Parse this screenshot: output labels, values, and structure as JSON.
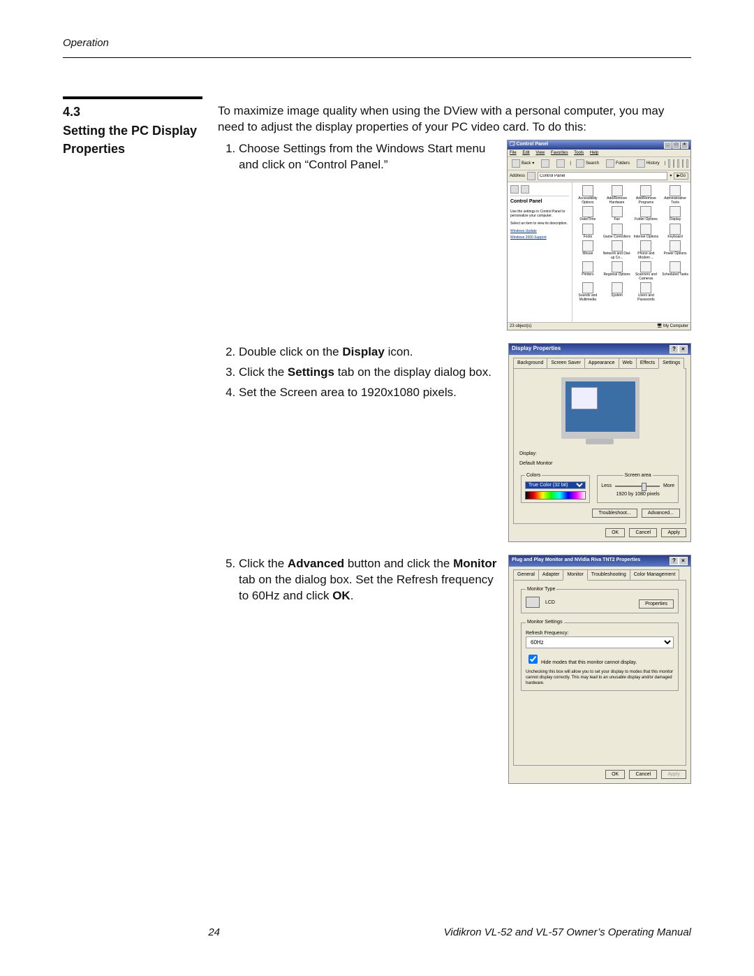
{
  "header": {
    "section_label": "Operation"
  },
  "section": {
    "number": "4.3",
    "title_line1": "Setting the PC Display",
    "title_line2": "Properties"
  },
  "intro": "To maximize image quality when using the DView with a personal computer, you may need to adjust the display properties of your PC video card. To do this:",
  "steps_a": {
    "s1": "Choose Settings from the Windows Start menu and click on “Control Panel.”"
  },
  "steps_b": {
    "s2_pre": "Double click on the ",
    "s2_bold": "Display",
    "s2_post": " icon.",
    "s3_pre": "Click the ",
    "s3_bold": "Settings",
    "s3_post": " tab on the display dialog box.",
    "s4": "Set the Screen area to 1920x1080 pixels."
  },
  "steps_c": {
    "s5_pre": "Click the ",
    "s5_b1": "Advanced",
    "s5_mid": " button and click the ",
    "s5_b2": "Monitor",
    "s5_mid2": " tab on the dialog box. Set the Refresh frequency to 60Hz and click ",
    "s5_b3": "OK",
    "s5_post": "."
  },
  "cp": {
    "title": "Control Panel",
    "menus": [
      "File",
      "Edit",
      "View",
      "Favorites",
      "Tools",
      "Help"
    ],
    "tools": {
      "back": "Back",
      "search": "Search",
      "folders": "Folders",
      "history": "History"
    },
    "address_label": "Address",
    "address_value": "Control Panel",
    "go": "Go",
    "side": {
      "head": "Control Panel",
      "desc1": "Use the settings in Control Panel to personalize your computer.",
      "desc2": "Select an item to view its description.",
      "link1": "Windows Update",
      "link2": "Windows 2000 Support"
    },
    "items": [
      "Accessibility Options",
      "Add/Remove Hardware",
      "Add/Remove Programs",
      "Administrative Tools",
      "Date/Time",
      "Fax",
      "Folder Options",
      "Display",
      "Fonts",
      "Game Controllers",
      "Internet Options",
      "Keyboard",
      "Mouse",
      "Network and Dial-up Co...",
      "Phone and Modem ...",
      "Power Options",
      "Printers",
      "Regional Options",
      "Scanners and Cameras",
      "Scheduled Tasks",
      "Sounds and Multimedia",
      "System",
      "Users and Passwords"
    ],
    "status_left": "23 object(s)",
    "status_right": "My Computer"
  },
  "dp": {
    "title": "Display Properties",
    "tabs": [
      "Background",
      "Screen Saver",
      "Appearance",
      "Web",
      "Effects",
      "Settings"
    ],
    "display_label": "Display:",
    "display_name": "Default Monitor",
    "colors_legend": "Colors",
    "colors_value": "True Color (32 bit)",
    "area_legend": "Screen area",
    "area_less": "Less",
    "area_more": "More",
    "area_value": "1920 by 1080 pixels",
    "troubleshoot": "Troubleshoot...",
    "advanced": "Advanced...",
    "ok": "OK",
    "cancel": "Cancel",
    "apply": "Apply"
  },
  "adv": {
    "title": "Plug and Play Monitor and NVidia Riva TNT2 Properties",
    "tabs": [
      "General",
      "Adapter",
      "Monitor",
      "Troubleshooting",
      "Color Management"
    ],
    "mon_type_legend": "Monitor Type",
    "mon_type_value": "LCD",
    "properties": "Properties",
    "mon_set_legend": "Monitor Settings",
    "refresh_label": "Refresh Frequency:",
    "refresh_value": "60Hz",
    "hide_label": "Hide modes that this monitor cannot display.",
    "warn": "Unchecking this box will allow you to set your display to modes that this monitor cannot display correctly. This may lead to an unusable display and/or damaged hardware.",
    "ok": "OK",
    "cancel": "Cancel",
    "apply": "Apply"
  },
  "footer": {
    "page": "24",
    "manual": "Vidikron VL-52 and VL-57 Owner’s Operating Manual"
  }
}
